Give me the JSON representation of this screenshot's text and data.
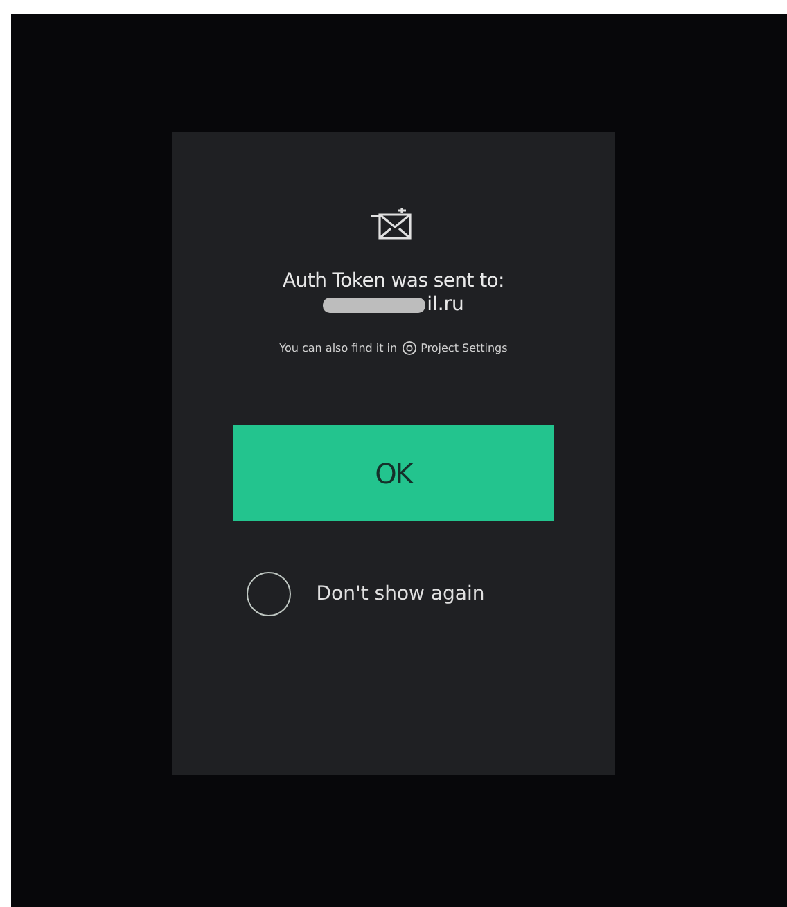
{
  "dialog": {
    "title": "Auth Token was sent to:",
    "email": "il.ru",
    "hint": {
      "before": "You can also find it in",
      "link": "Project Settings"
    },
    "ok_button": "OK",
    "dont_show_again": {
      "label": "Don't show again",
      "checked": false
    }
  }
}
